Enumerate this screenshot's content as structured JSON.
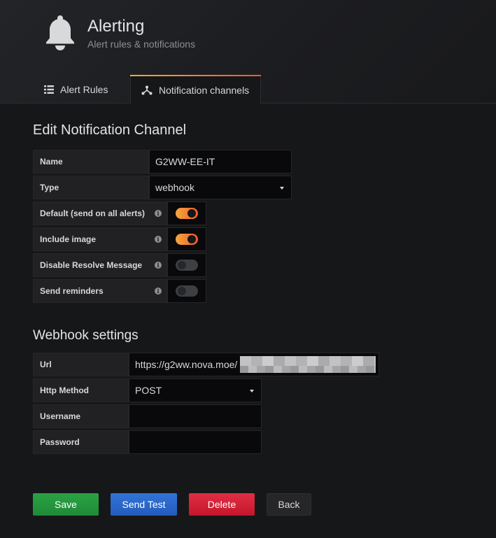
{
  "header": {
    "title": "Alerting",
    "subtitle": "Alert rules & notifications",
    "icon": "bell-icon"
  },
  "tabs": [
    {
      "label": "Alert Rules",
      "icon": "list-icon",
      "active": false
    },
    {
      "label": "Notification channels",
      "icon": "channels-icon",
      "active": true
    }
  ],
  "edit": {
    "title": "Edit Notification Channel",
    "name_label": "Name",
    "name_value": "G2WW-EE-IT",
    "type_label": "Type",
    "type_value": "webhook",
    "default_label": "Default (send on all alerts)",
    "default_on": true,
    "include_image_label": "Include image",
    "include_image_on": true,
    "disable_resolve_label": "Disable Resolve Message",
    "disable_resolve_on": false,
    "send_reminders_label": "Send reminders",
    "send_reminders_on": false
  },
  "webhook": {
    "title": "Webhook settings",
    "url_label": "Url",
    "url_value": "https://g2ww.nova.moe/",
    "method_label": "Http Method",
    "method_value": "POST",
    "username_label": "Username",
    "username_value": "",
    "password_label": "Password",
    "password_value": ""
  },
  "actions": {
    "save": "Save",
    "send_test": "Send Test",
    "delete": "Delete",
    "back": "Back"
  },
  "colors": {
    "accent_orange": "#f15a2b",
    "save_green": "#1f8b37",
    "test_blue": "#245bbb",
    "delete_red": "#c4162a"
  }
}
